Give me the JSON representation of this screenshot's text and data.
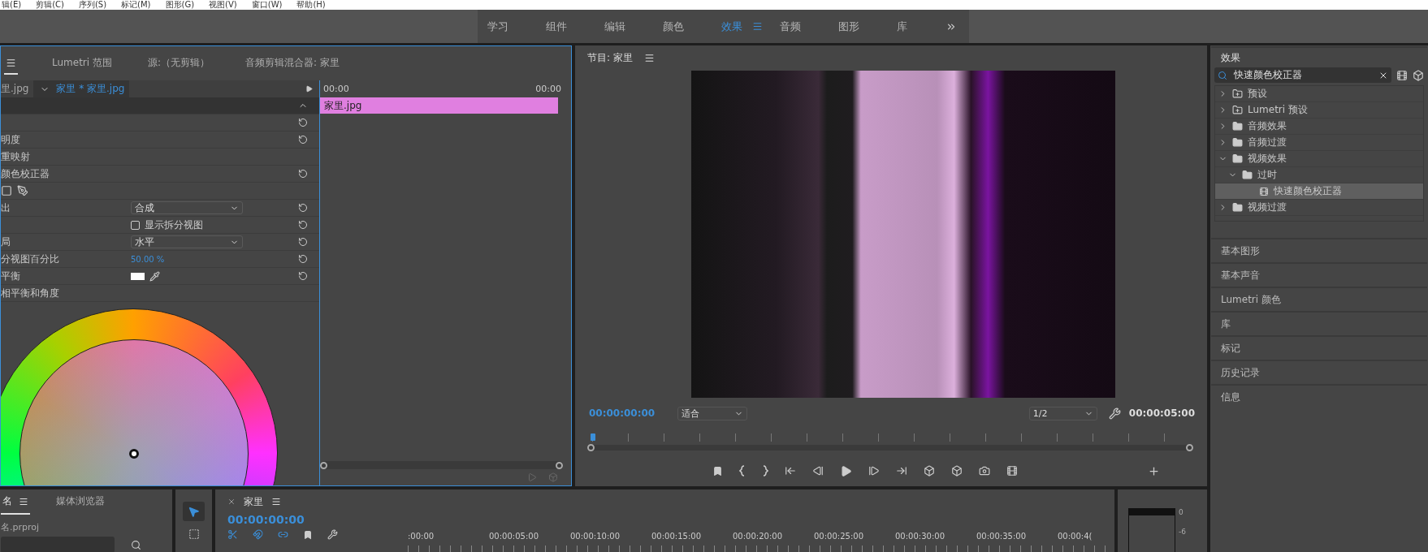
{
  "menu": [
    "辑(E)",
    "剪辑(C)",
    "序列(S)",
    "标记(M)",
    "图形(G)",
    "视图(V)",
    "窗口(W)",
    "帮助(H)"
  ],
  "workspaces": [
    {
      "label": "学习",
      "selected": false
    },
    {
      "label": "组件",
      "selected": false
    },
    {
      "label": "编辑",
      "selected": false
    },
    {
      "label": "颜色",
      "selected": false
    },
    {
      "label": "效果",
      "selected": true
    },
    {
      "label": "音频",
      "selected": false
    },
    {
      "label": "图形",
      "selected": false
    },
    {
      "label": "库",
      "selected": false
    }
  ],
  "effect_controls": {
    "tabs": [
      {
        "selected": true
      },
      {
        "label": "Lumetri 范围",
        "selected": false
      },
      {
        "label": "源:（无剪辑）",
        "selected": false
      },
      {
        "label": "音频剪辑混合器: 家里",
        "selected": false
      }
    ],
    "source_clip": "里.jpg",
    "sequence_clip": "家里 * 家里.jpg",
    "properties": [
      {
        "kind": "section"
      },
      {
        "kind": "text",
        "reset": true
      },
      {
        "kind": "text",
        "label": "明度",
        "reset": true
      },
      {
        "kind": "text",
        "label": "重映射",
        "reset": false
      },
      {
        "kind": "text",
        "label": "颜色校正器",
        "reset": true
      },
      {
        "kind": "tools",
        "reset": false
      },
      {
        "kind": "dropdown",
        "label": "出",
        "value": "合成",
        "reset": true
      },
      {
        "kind": "checkbox",
        "text": "显示拆分视图",
        "checked": false,
        "reset": true
      },
      {
        "kind": "dropdown",
        "label": "局",
        "value": "水平",
        "reset": true
      },
      {
        "kind": "number",
        "label": "分视图百分比",
        "value": "50.00 %",
        "reset": true
      },
      {
        "kind": "swatch",
        "label": "平衡",
        "reset": true
      },
      {
        "kind": "text",
        "label": "相平衡和角度",
        "reset": false
      }
    ],
    "mini_timeline": {
      "start": "00:00",
      "end": "00:00",
      "clip": "家里.jpg"
    }
  },
  "program": {
    "title": "节目: 家里",
    "timecode": "00:00:00:00",
    "fit": "适合",
    "resolution": "1/2",
    "duration": "00:00:05:00"
  },
  "effects": {
    "title": "效果",
    "search": "快速颜色校正器",
    "tree": [
      {
        "label": "预设",
        "kind": "preset",
        "expanded": false,
        "selected": false
      },
      {
        "label": "Lumetri 预设",
        "kind": "preset",
        "expanded": false,
        "selected": false
      },
      {
        "label": "音频效果",
        "kind": "folder",
        "expanded": false,
        "selected": false
      },
      {
        "label": "音频过渡",
        "kind": "folder",
        "expanded": false,
        "selected": false
      },
      {
        "label": "视频效果",
        "kind": "folder",
        "expanded": true,
        "selected": false,
        "children": [
          {
            "label": "过时",
            "kind": "folder",
            "expanded": true,
            "selected": false,
            "children": [
              {
                "label": "快速颜色校正器",
                "kind": "effect",
                "selected": true
              }
            ]
          }
        ]
      },
      {
        "label": "视频过渡",
        "kind": "folder",
        "expanded": false,
        "selected": false
      }
    ],
    "sections": [
      "基本图形",
      "基本声音",
      "Lumetri 颜色",
      "库",
      "标记",
      "历史记录",
      "信息"
    ]
  },
  "project": {
    "tabs": [
      {
        "label": "名",
        "selected": true
      },
      {
        "label": "媒体浏览器",
        "selected": false
      }
    ],
    "file": "名.prproj"
  },
  "tools": [
    {
      "kind": "selection",
      "selected": true
    },
    {
      "kind": "track_select",
      "selected": false
    }
  ],
  "timeline": {
    "title": "家里",
    "timecode": "00:00:00:00",
    "ruler": [
      ":00:00",
      "00:00:05:00",
      "00:00:10:00",
      "00:00:15:00",
      "00:00:20:00",
      "00:00:25:00",
      "00:00:30:00",
      "00:00:35:00",
      "00:00:4("
    ]
  },
  "meter": {
    "ticks": [
      "0",
      "-6"
    ]
  }
}
